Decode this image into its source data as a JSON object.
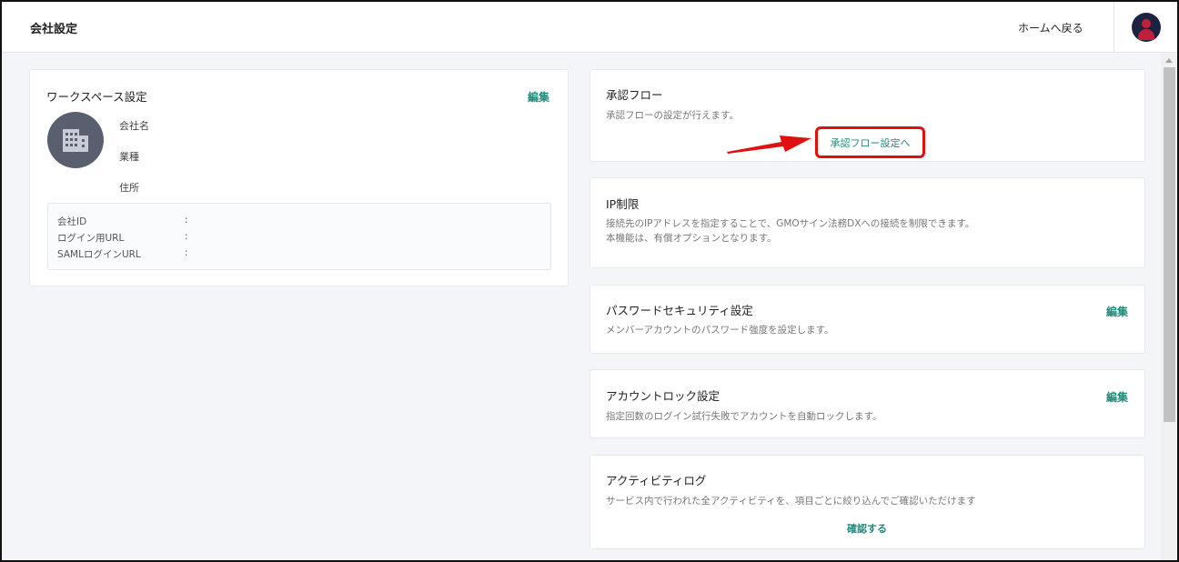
{
  "header": {
    "title": "会社設定",
    "home_link": "ホームへ戻る"
  },
  "workspace": {
    "title": "ワークスペース設定",
    "edit_label": "編集",
    "fields": [
      "会社名",
      "業種",
      "住所"
    ],
    "info_rows": [
      {
        "label": "会社ID",
        "sep": ":"
      },
      {
        "label": "ログイン用URL",
        "sep": ":"
      },
      {
        "label": "SAMLログインURL",
        "sep": ":"
      }
    ]
  },
  "approval_flow": {
    "title": "承認フロー",
    "description": "承認フローの設定が行えます。",
    "button_label": "承認フロー設定へ"
  },
  "ip_restriction": {
    "title": "IP制限",
    "description_line1": "接続先のIPアドレスを指定することで、GMOサイン法務DXへの接続を制限できます。",
    "description_line2": "本機能は、有償オプションとなります。"
  },
  "password_security": {
    "title": "パスワードセキュリティ設定",
    "description": "メンバーアカウントのパスワード強度を設定します。",
    "edit_label": "編集"
  },
  "account_lock": {
    "title": "アカウントロック設定",
    "description": "指定回数のログイン試行失敗でアカウントを自動ロックします。",
    "edit_label": "編集"
  },
  "activity_log": {
    "title": "アクティビティログ",
    "description": "サービス内で行われた全アクティビティを、項目ごとに絞り込んでご確認いただけます",
    "link_label": "確認する"
  },
  "colors": {
    "accent": "#1f8a7a",
    "highlight": "#e01010",
    "avatar_bg": "#1c2340"
  }
}
